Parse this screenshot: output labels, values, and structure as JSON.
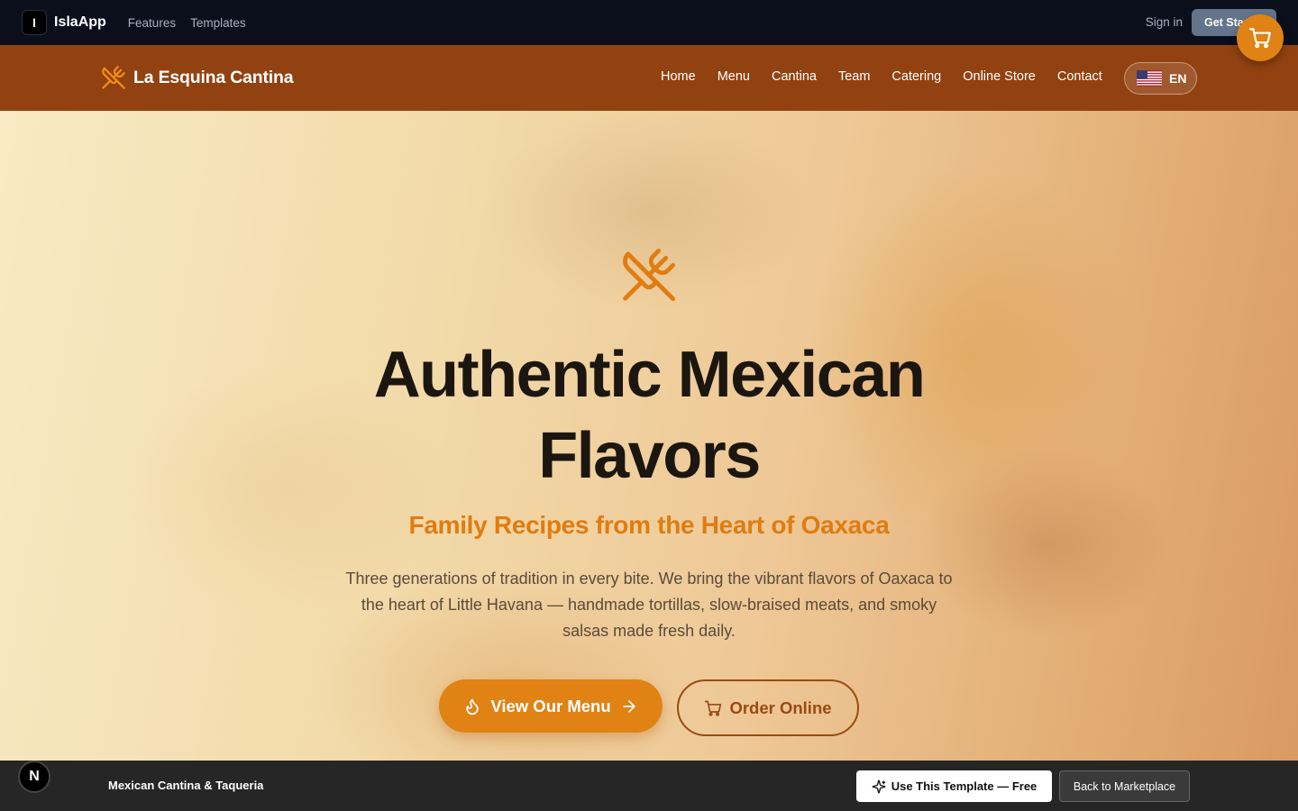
{
  "platform": {
    "logo_letter": "I",
    "brand": "IslaApp",
    "nav": [
      "Features",
      "Templates"
    ],
    "signin": "Sign in",
    "get_started": "Get Started"
  },
  "site": {
    "name": "La Esquina Cantina",
    "nav": [
      "Home",
      "Menu",
      "Cantina",
      "Team",
      "Catering",
      "Online Store",
      "Contact"
    ],
    "language": "EN"
  },
  "hero": {
    "title": "Authentic Mexican Flavors",
    "subtitle": "Family Recipes from the Heart of Oaxaca",
    "description": "Three generations of tradition in every bite. We bring the vibrant flavors of Oaxaca to the heart of Little Havana — handmade tortillas, slow-braised meats, and smoky salsas made fresh daily.",
    "primary_cta": "View Our Menu",
    "secondary_cta": "Order Online"
  },
  "marketplace_bar": {
    "badge": "N",
    "title": "Mexican Cantina & Taqueria",
    "use_template": "Use This Template — Free",
    "back": "Back to Marketplace"
  },
  "colors": {
    "accent": "#e08214",
    "header": "#924210",
    "topbar": "#0b0f1c",
    "bottombar": "#262626"
  },
  "icons": {
    "brand": "utensils-crossed-icon",
    "cart": "shopping-cart-icon",
    "flag": "us-flag-icon",
    "flame": "flame-icon",
    "arrow": "arrow-right-icon",
    "sparkles": "sparkles-icon"
  }
}
